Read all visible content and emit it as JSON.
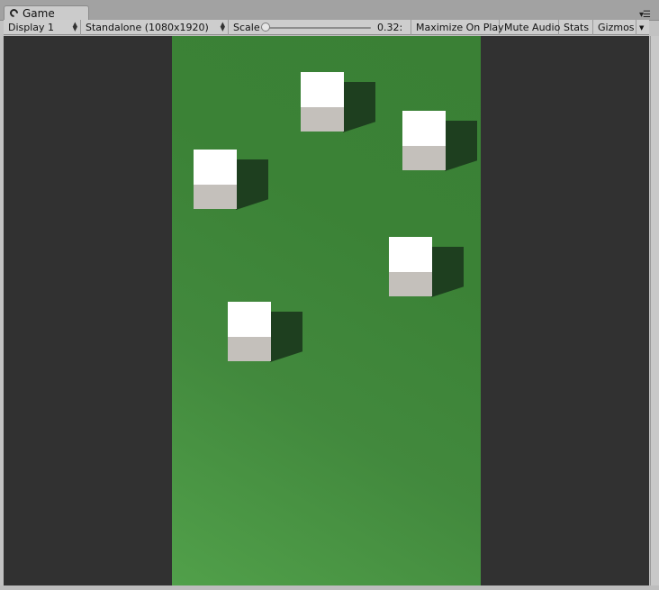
{
  "tab": {
    "title": "Game"
  },
  "toolbar": {
    "display": "Display 1",
    "resolution": "Standalone (1080x1920)",
    "scale_label": "Scale",
    "scale_value": "0.32:",
    "maximize": "Maximize On Play",
    "mute": "Mute Audio",
    "stats": "Stats",
    "gizmos": "Gizmos"
  },
  "scene": {
    "ground_color": "#3b8236",
    "background_color": "#313131",
    "cube_count": 5
  }
}
